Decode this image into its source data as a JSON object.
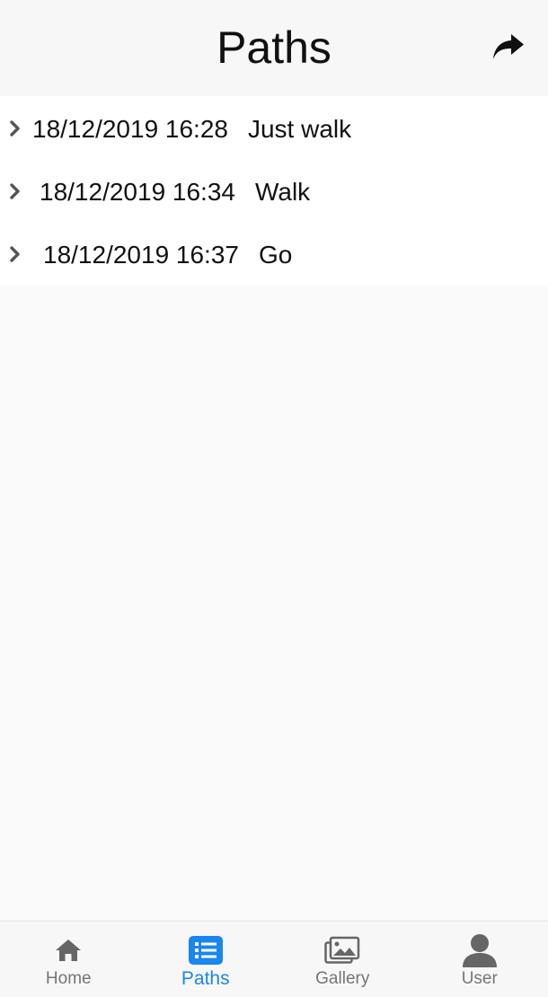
{
  "header": {
    "title": "Paths",
    "share_icon": "share-arrow-icon"
  },
  "paths": [
    {
      "date": "18/12/2019 16:28",
      "name": "Just walk"
    },
    {
      "date": "18/12/2019 16:34",
      "name": "Walk"
    },
    {
      "date": "18/12/2019 16:37",
      "name": "Go"
    }
  ],
  "tabbar": {
    "tabs": [
      {
        "label": "Home",
        "icon": "home-icon",
        "active": false
      },
      {
        "label": "Paths",
        "icon": "list-icon",
        "active": true
      },
      {
        "label": "Gallery",
        "icon": "gallery-icon",
        "active": false
      },
      {
        "label": "User",
        "icon": "user-icon",
        "active": false
      }
    ]
  },
  "colors": {
    "accent": "#1a86f0",
    "inactive": "#757575",
    "text": "#111111",
    "background": "#f9f9f9"
  }
}
